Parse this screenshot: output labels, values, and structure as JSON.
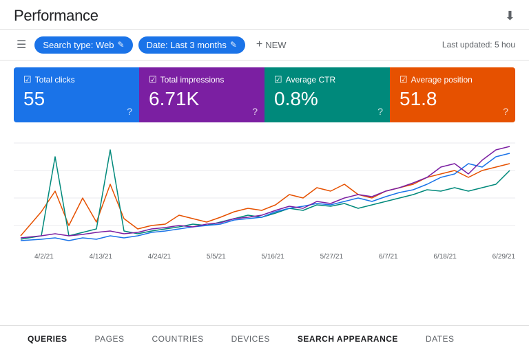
{
  "header": {
    "title": "Performance",
    "download_icon": "⬇"
  },
  "toolbar": {
    "filter_icon": "☰",
    "search_type_label": "Search type: Web",
    "edit_icon": "✎",
    "date_label": "Date: Last 3 months",
    "new_label": "NEW",
    "plus_icon": "+",
    "last_updated": "Last updated: 5 hou"
  },
  "metrics": [
    {
      "id": "total-clicks",
      "label": "Total clicks",
      "value": "55",
      "color": "blue",
      "checked": true
    },
    {
      "id": "total-impressions",
      "label": "Total impressions",
      "value": "6.71K",
      "color": "purple",
      "checked": true
    },
    {
      "id": "average-ctr",
      "label": "Average CTR",
      "value": "0.8%",
      "color": "teal",
      "checked": true
    },
    {
      "id": "average-position",
      "label": "Average position",
      "value": "51.8",
      "color": "orange",
      "checked": true
    }
  ],
  "chart": {
    "dates": [
      "4/2/21",
      "4/13/21",
      "4/24/21",
      "5/5/21",
      "5/16/21",
      "5/27/21",
      "6/7/21",
      "6/18/21",
      "6/29/21"
    ],
    "lines": {
      "clicks": {
        "color": "#1a73e8"
      },
      "impressions": {
        "color": "#00897b"
      },
      "ctr": {
        "color": "#e65100"
      },
      "position": {
        "color": "#7b1fa2"
      }
    }
  },
  "tabs": [
    {
      "label": "QUERIES",
      "active": false,
      "bold": true
    },
    {
      "label": "PAGES",
      "active": false,
      "bold": false
    },
    {
      "label": "COUNTRIES",
      "active": false,
      "bold": false
    },
    {
      "label": "DEVICES",
      "active": false,
      "bold": false
    },
    {
      "label": "SEARCH APPEARANCE",
      "active": false,
      "bold": true
    },
    {
      "label": "DATES",
      "active": false,
      "bold": false
    }
  ]
}
